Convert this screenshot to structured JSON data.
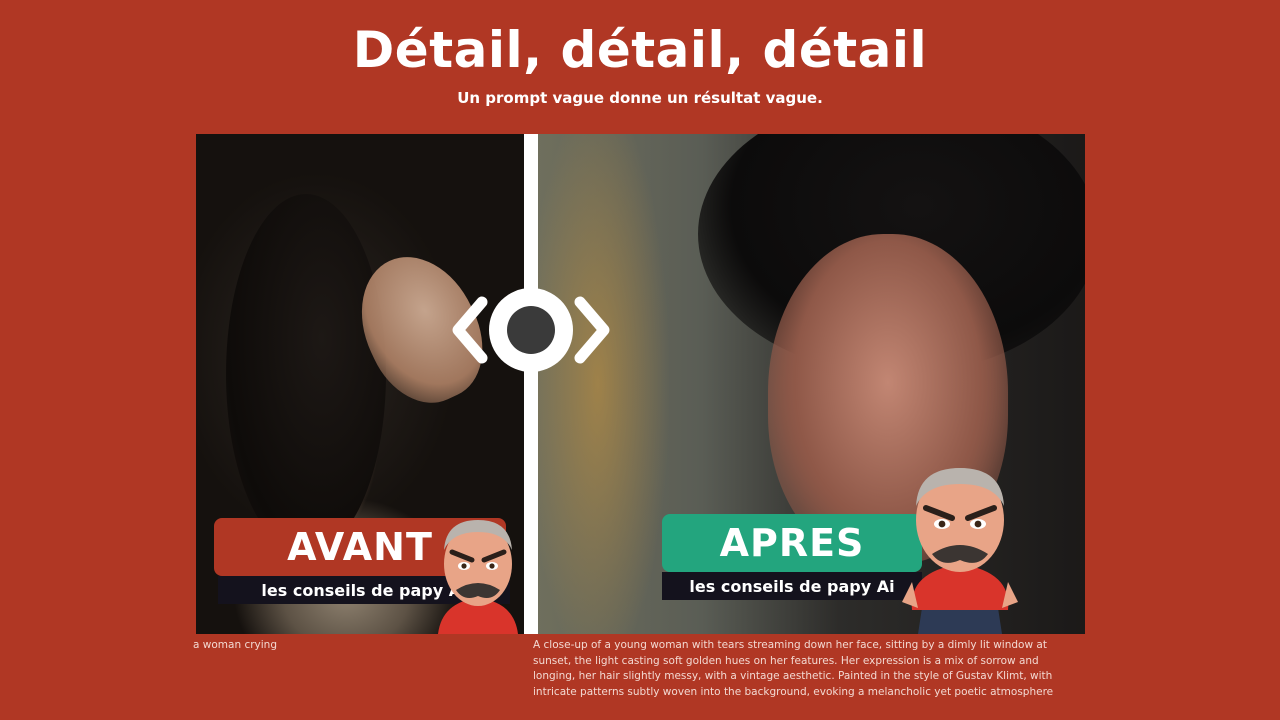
{
  "header": {
    "title": "Détail, détail, détail",
    "subtitle": "Un prompt vague donne un résultat vague."
  },
  "comparison": {
    "before": {
      "badge_label": "AVANT",
      "badge_sub": "les conseils de papy Ai",
      "badge_color": "#b03724",
      "prompt": "a woman crying"
    },
    "after": {
      "badge_label": "APRES",
      "badge_sub": "les conseils de papy Ai",
      "badge_color": "#23a57e",
      "prompt": "A close-up of a young woman with tears streaming down her face, sitting by a dimly lit window at sunset, the light casting soft golden hues on her features. Her expression is a mix of sorrow and longing, her hair slightly messy, with a vintage aesthetic. Painted in the style of Gustav Klimt, with intricate patterns subtly woven into the background, evoking a melancholic yet poetic atmosphere"
    },
    "slider_icon": "compare-slider-icon"
  },
  "colors": {
    "background": "#b03724",
    "accent_green": "#23a57e",
    "sub_banner": "#14121d",
    "text": "#ffffff"
  }
}
